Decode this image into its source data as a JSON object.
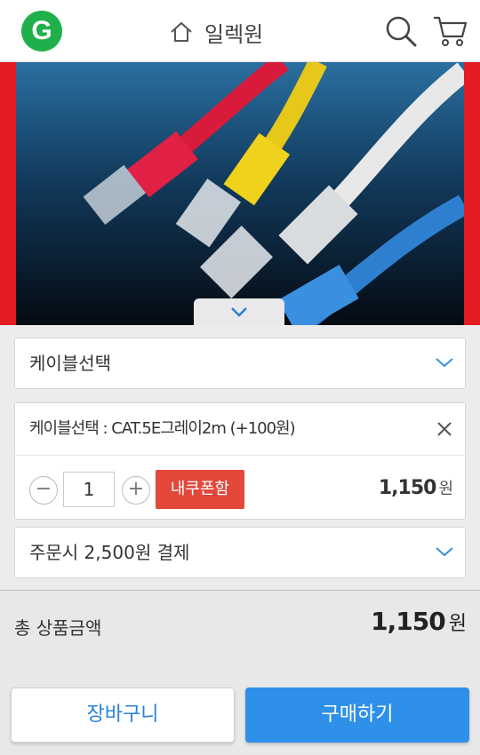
{
  "header": {
    "logo_letter": "G",
    "shop_name": "일렉원"
  },
  "product": {
    "option_select_label": "케이블선택",
    "selected_option": {
      "title": "케이블선택 : CAT.5E그레이2m (+100원)",
      "quantity": "1",
      "coupon_label": "내쿠폰함",
      "price": "1,150",
      "price_unit": "원"
    },
    "payment_select_label": "주문시 2,500원 결제"
  },
  "total": {
    "label": "총 상품금액",
    "value": "1,150",
    "unit": "원"
  },
  "actions": {
    "cart_label": "장바구니",
    "buy_label": "구매하기"
  },
  "colors": {
    "brand_green": "#20b04b",
    "accent_blue": "#2e90e8",
    "coupon_red": "#e2473a",
    "hero_red": "#e31b23"
  },
  "icons": [
    "home-icon",
    "search-icon",
    "cart-icon",
    "chevron-down-icon",
    "close-icon",
    "minus-icon",
    "plus-icon"
  ]
}
